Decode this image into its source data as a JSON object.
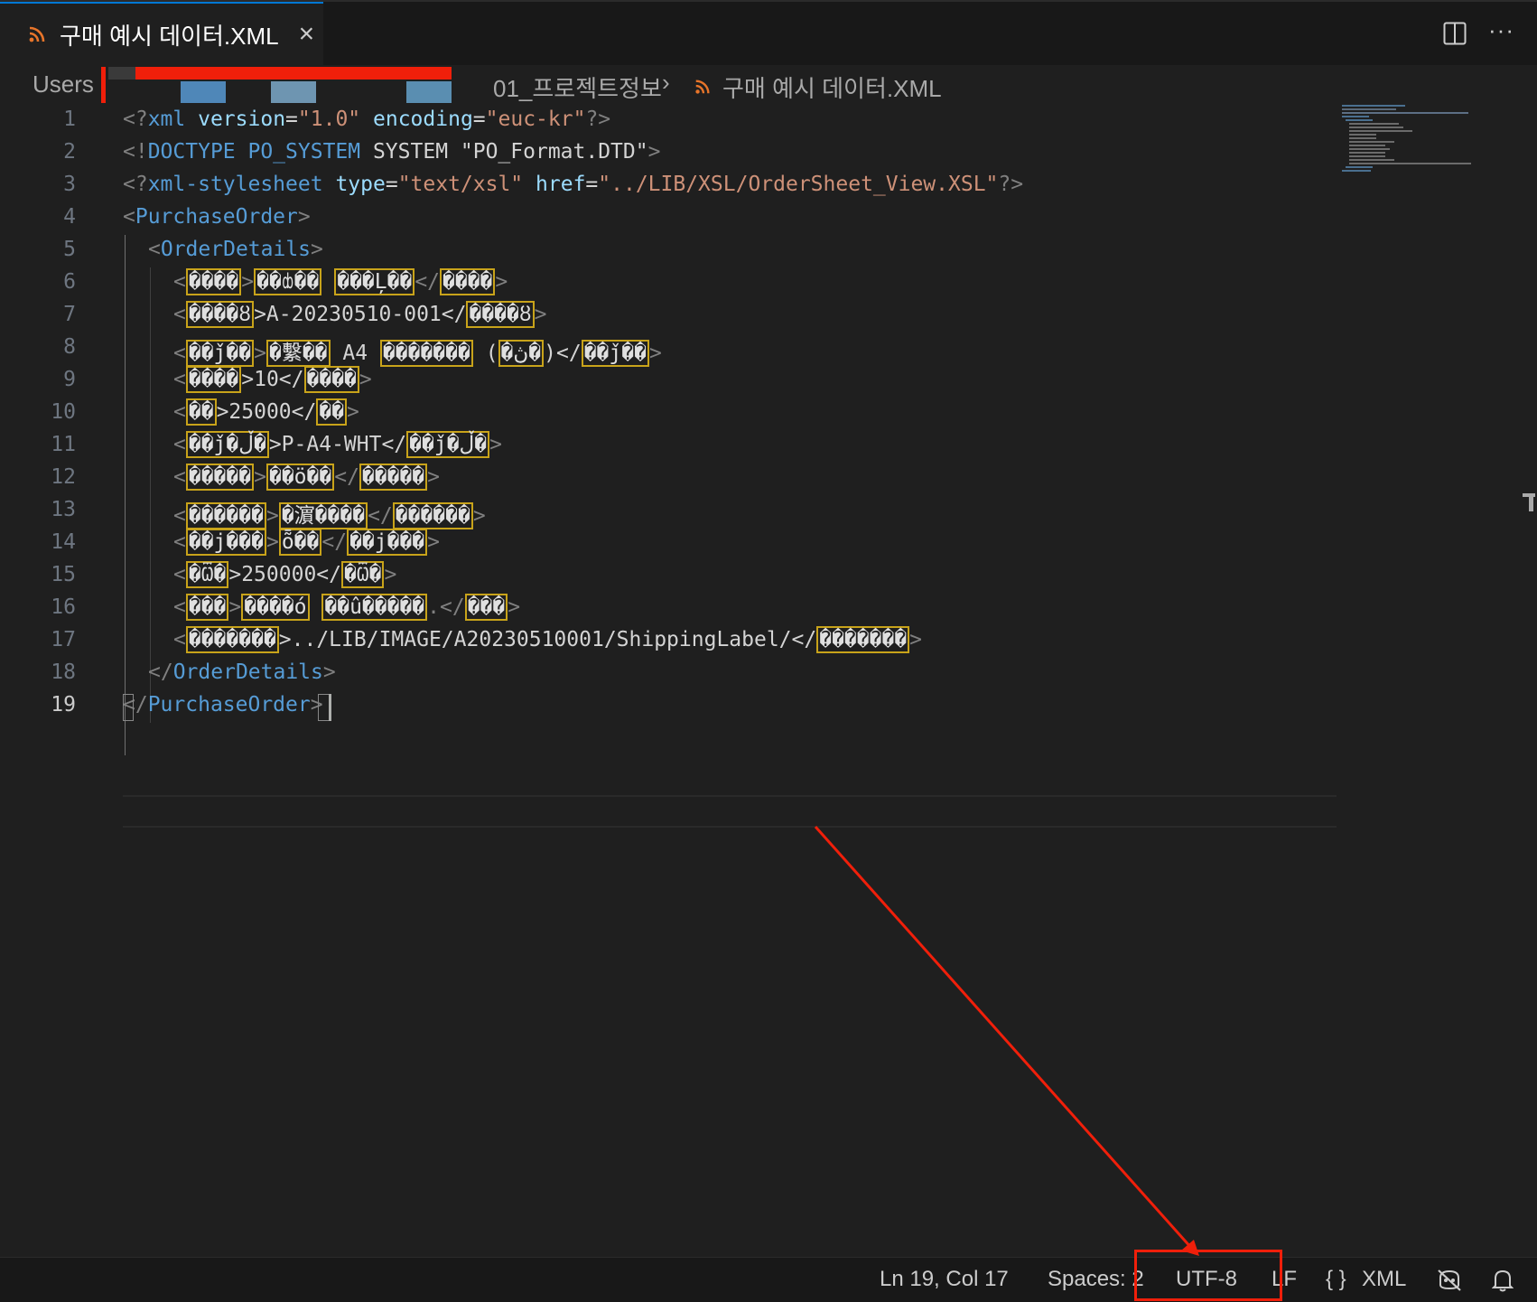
{
  "tab": {
    "title": "구매 예시 데이터.XML",
    "close": "×",
    "icon": "rss-icon"
  },
  "toolbar": {
    "more": "···"
  },
  "breadcrumb": {
    "root": "Users",
    "folder": "01_프로젝트정보",
    "separator": "›",
    "file": "구매 예시 데이터.XML"
  },
  "editor": {
    "active_line": 19,
    "lines": [
      {
        "n": "1"
      },
      {
        "n": "2"
      },
      {
        "n": "3"
      },
      {
        "n": "4"
      },
      {
        "n": "5"
      },
      {
        "n": "6"
      },
      {
        "n": "7"
      },
      {
        "n": "8"
      },
      {
        "n": "9"
      },
      {
        "n": "10"
      },
      {
        "n": "11"
      },
      {
        "n": "12"
      },
      {
        "n": "13"
      },
      {
        "n": "14"
      },
      {
        "n": "15"
      },
      {
        "n": "16"
      },
      {
        "n": "17"
      },
      {
        "n": "18"
      },
      {
        "n": "19"
      }
    ],
    "code": {
      "l1": {
        "a": "<?",
        "b": "xml",
        "c": " ",
        "d": "version",
        "e": "=",
        "f": "\"1.0\"",
        "g": " ",
        "h": "encoding",
        "i": "=",
        "j": "\"euc-kr\"",
        "k": "?>"
      },
      "l2": {
        "a": "<!",
        "b": "DOCTYPE PO_SYSTEM",
        "c": " SYSTEM \"PO_Format.DTD\"",
        "d": ">"
      },
      "l3": {
        "a": "<?",
        "b": "xml-stylesheet",
        "c": " ",
        "d": "type",
        "e": "=",
        "f": "\"text/xsl\"",
        "g": " ",
        "h": "href",
        "i": "=",
        "j": "\"../LIB/XSL/OrderSheet_View.XSL\"",
        "k": "?>"
      },
      "l4": {
        "a": "<",
        "b": "PurchaseOrder",
        "c": ">"
      },
      "l5": {
        "a": "<",
        "b": "OrderDetails",
        "c": ">"
      },
      "l6": {
        "a": "<",
        "b": "����",
        "c": ">",
        "d": "��ȸ��",
        "e": " ",
        "f": "���Ļ��",
        "g": "</",
        "h": "����",
        "i": ">"
      },
      "l7": {
        "a": "<",
        "b": "����ȣ",
        "c": ">A-20230510-001</",
        "d": "����ȣ",
        "e": ">"
      },
      "l8": {
        "a": "<",
        "b": "��ǰ��",
        "c": ">",
        "d": "�繫��",
        "e": " A4 ",
        "f": "�������",
        "g": " (",
        "h": "�ڽ�",
        "i": ")</",
        "j": "��ǰ��",
        "k": ">"
      },
      "l9": {
        "a": "<",
        "b": "����",
        "c": ">10</",
        "d": "����",
        "e": ">"
      },
      "l10": {
        "a": "<",
        "b": "��",
        "c": ">25000</",
        "d": "��",
        "e": ">"
      },
      "l11": {
        "a": "<",
        "b": "��ǰ�ڵ�",
        "c": ">P-A4-WHT</",
        "d": "��ǰ�ڵ�",
        "e": ">"
      },
      "l12": {
        "a": "<",
        "b": "�����",
        "c": ">",
        "d": "��ö��",
        "e": "</",
        "f": "�����",
        "g": ">"
      },
      "l13": {
        "a": "<",
        "b": "������",
        "c": ">",
        "d": "�濵����",
        "e": "</",
        "f": "������",
        "g": ">"
      },
      "l14": {
        "a": "<",
        "b": "��ϳ���",
        "c": ">",
        "d": "ȭ��",
        "e": "</",
        "f": "��ϳ���",
        "g": ">"
      },
      "l15": {
        "a": "<",
        "b": "�Ѿ�",
        "c": ">250000</",
        "d": "�Ѿ�",
        "e": ">"
      },
      "l16": {
        "a": "<",
        "b": "���",
        "c": ">",
        "d": "����ó",
        "e": " ",
        "f": "��û�����",
        "g": ".</",
        "h": "���",
        "i": ">"
      },
      "l17": {
        "a": "<",
        "b": "�������",
        "c": ">../LIB/IMAGE/A20230510001/ShippingLabel/</",
        "d": "�������",
        "e": ">"
      },
      "l18": {
        "a": "</",
        "b": "OrderDetails",
        "c": ">"
      },
      "l19": {
        "a": "</",
        "b": "PurchaseOrder",
        "c": ">"
      }
    }
  },
  "status": {
    "position": "Ln 19, Col 17",
    "spaces": "Spaces: 2",
    "encoding": "UTF-8",
    "eol": "LF",
    "lang_icon": "{ }",
    "language": "XML",
    "copilot_icon": "copilot-disabled-icon",
    "bell_icon": "bell-icon"
  },
  "colors": {
    "annotation": "#f01f0a",
    "tag": "#569cd6",
    "attr": "#9cdcfe",
    "string": "#ce9178",
    "bracket": "#808080",
    "invalid_char_box": "#c8a31a",
    "rss": "#e8752a"
  }
}
